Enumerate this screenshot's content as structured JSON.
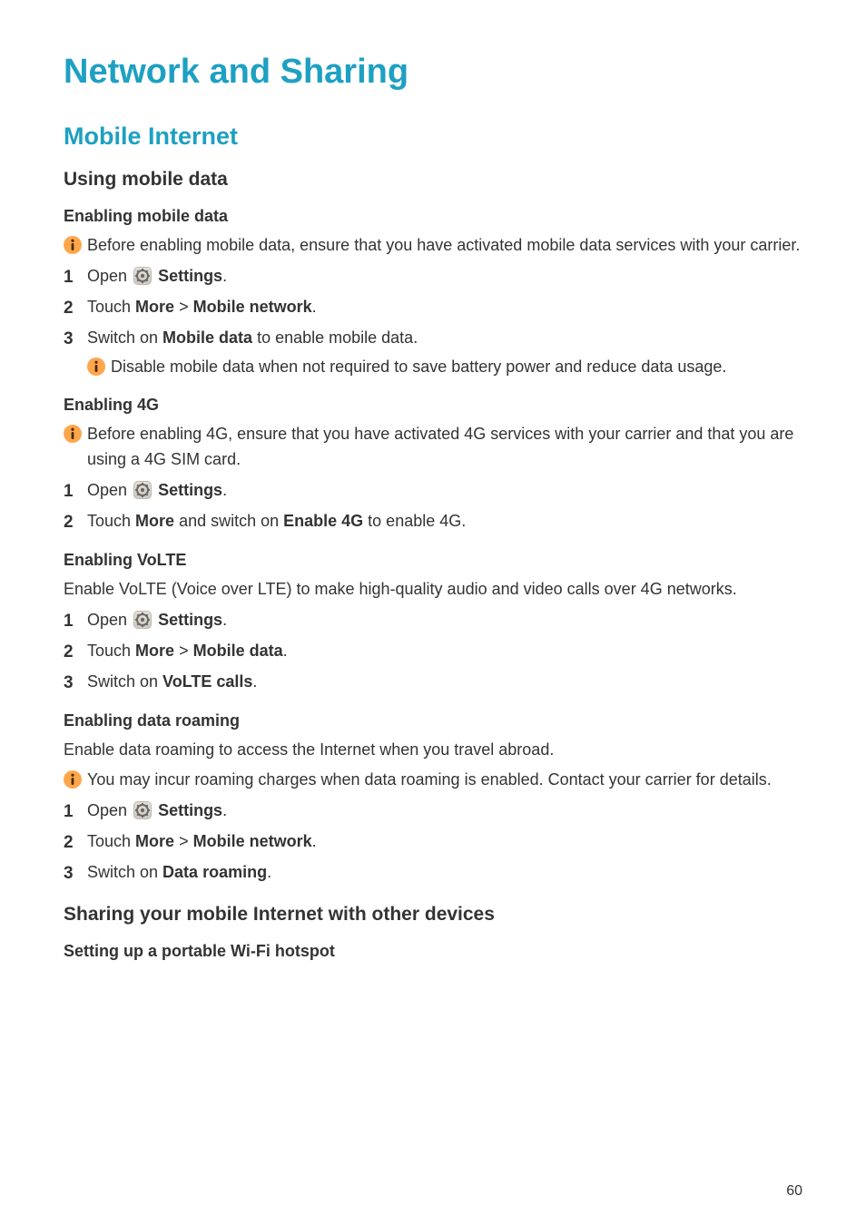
{
  "page_number": "60",
  "chapter_title": "Network and Sharing",
  "section_title": "Mobile Internet",
  "h3_using_mobile_data": "Using mobile data",
  "h4_enabling_mobile_data": "Enabling mobile data",
  "info_enabling_mobile_data": " Before enabling mobile data, ensure that you have activated mobile data services with your carrier.",
  "steps_mobile_data": {
    "s1": {
      "num": "1",
      "pre": "Open ",
      "app": "Settings",
      "post": "."
    },
    "s2": {
      "num": "2",
      "pre": "Touch ",
      "b1": "More",
      "sep": " > ",
      "b2": "Mobile network",
      "post": "."
    },
    "s3": {
      "num": "3",
      "pre": "Switch on ",
      "b1": "Mobile data",
      "post": " to enable mobile data."
    },
    "s3_sub_info": " Disable mobile data when not required to save battery power and reduce data usage."
  },
  "h4_enabling_4g": "Enabling 4G",
  "info_enabling_4g": " Before enabling 4G, ensure that you have activated 4G services with your carrier and that you are using a 4G SIM card.",
  "steps_4g": {
    "s1": {
      "num": "1",
      "pre": "Open ",
      "app": "Settings",
      "post": "."
    },
    "s2": {
      "num": "2",
      "pre": "Touch ",
      "b1": "More",
      "mid": " and switch on ",
      "b2": "Enable 4G",
      "post": " to enable 4G."
    }
  },
  "h4_enabling_volte": "Enabling VoLTE",
  "p_volte": "Enable VoLTE (Voice over LTE) to make high-quality audio and video calls over 4G networks.",
  "steps_volte": {
    "s1": {
      "num": "1",
      "pre": "Open ",
      "app": "Settings",
      "post": "."
    },
    "s2": {
      "num": "2",
      "pre": "Touch ",
      "b1": "More",
      "sep": " > ",
      "b2": "Mobile data",
      "post": "."
    },
    "s3": {
      "num": "3",
      "pre": "Switch on ",
      "b1": "VoLTE calls",
      "post": "."
    }
  },
  "h4_enabling_data_roaming": "Enabling data roaming",
  "p_data_roaming": "Enable data roaming to access the Internet when you travel abroad.",
  "info_data_roaming": " You may incur roaming charges when data roaming is enabled. Contact your carrier for details.",
  "steps_data_roaming": {
    "s1": {
      "num": "1",
      "pre": "Open ",
      "app": "Settings",
      "post": "."
    },
    "s2": {
      "num": "2",
      "pre": "Touch ",
      "b1": "More",
      "sep": " > ",
      "b2": "Mobile network",
      "post": "."
    },
    "s3": {
      "num": "3",
      "pre": "Switch on ",
      "b1": "Data roaming",
      "post": "."
    }
  },
  "h3_sharing": "Sharing your mobile Internet with other devices",
  "h4_hotspot": "Setting up a portable Wi-Fi hotspot"
}
